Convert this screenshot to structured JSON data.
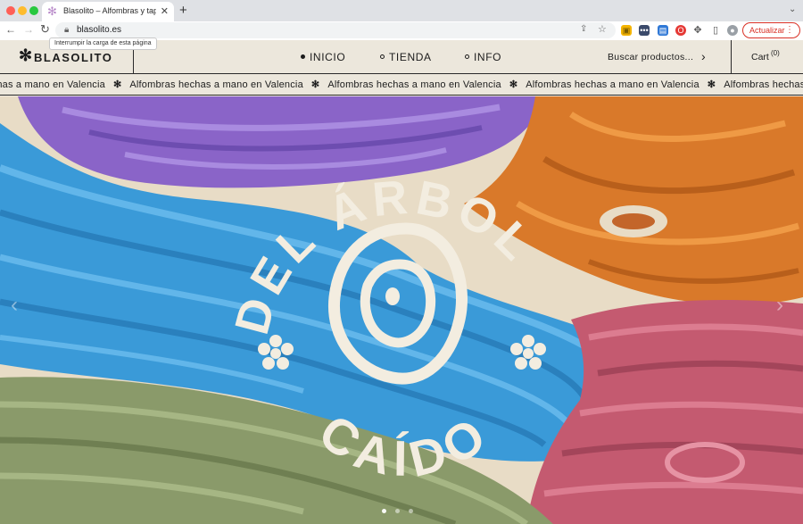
{
  "browser": {
    "tab_title": "Blasolito – Alfombras y tapices",
    "url": "blasolito.es",
    "tooltip": "Interrumpir la carga de esta página",
    "update_label": "Actualizar"
  },
  "site": {
    "logo": "BLASOLITO",
    "nav": [
      {
        "label": "INICIO",
        "active": true
      },
      {
        "label": "TIENDA",
        "active": false
      },
      {
        "label": "INFO",
        "active": false
      }
    ],
    "search_placeholder": "Buscar productos...",
    "cart_label": "Cart",
    "cart_count": "(0)"
  },
  "marquee": {
    "items": [
      "hechas a mano en Valencia",
      "Alfombras hechas a mano en Valencia",
      "Alfombras hechas a mano en Valencia",
      "Alfombras hechas a mano en Valencia",
      "Alfombras hechas a mano en Valencia"
    ],
    "separator": "✻"
  },
  "hero": {
    "badge_top": "DEL ÁRBOL",
    "badge_bottom": "CAÍDO",
    "slide_count": 3,
    "active_slide": 1
  },
  "colors": {
    "cream": "#ece7dc",
    "purple": "#8a64c8",
    "blue": "#3a9ad8",
    "orange": "#d9792a",
    "pink": "#c45a70",
    "green": "#8a9a6a",
    "badge": "#f3ede0"
  }
}
